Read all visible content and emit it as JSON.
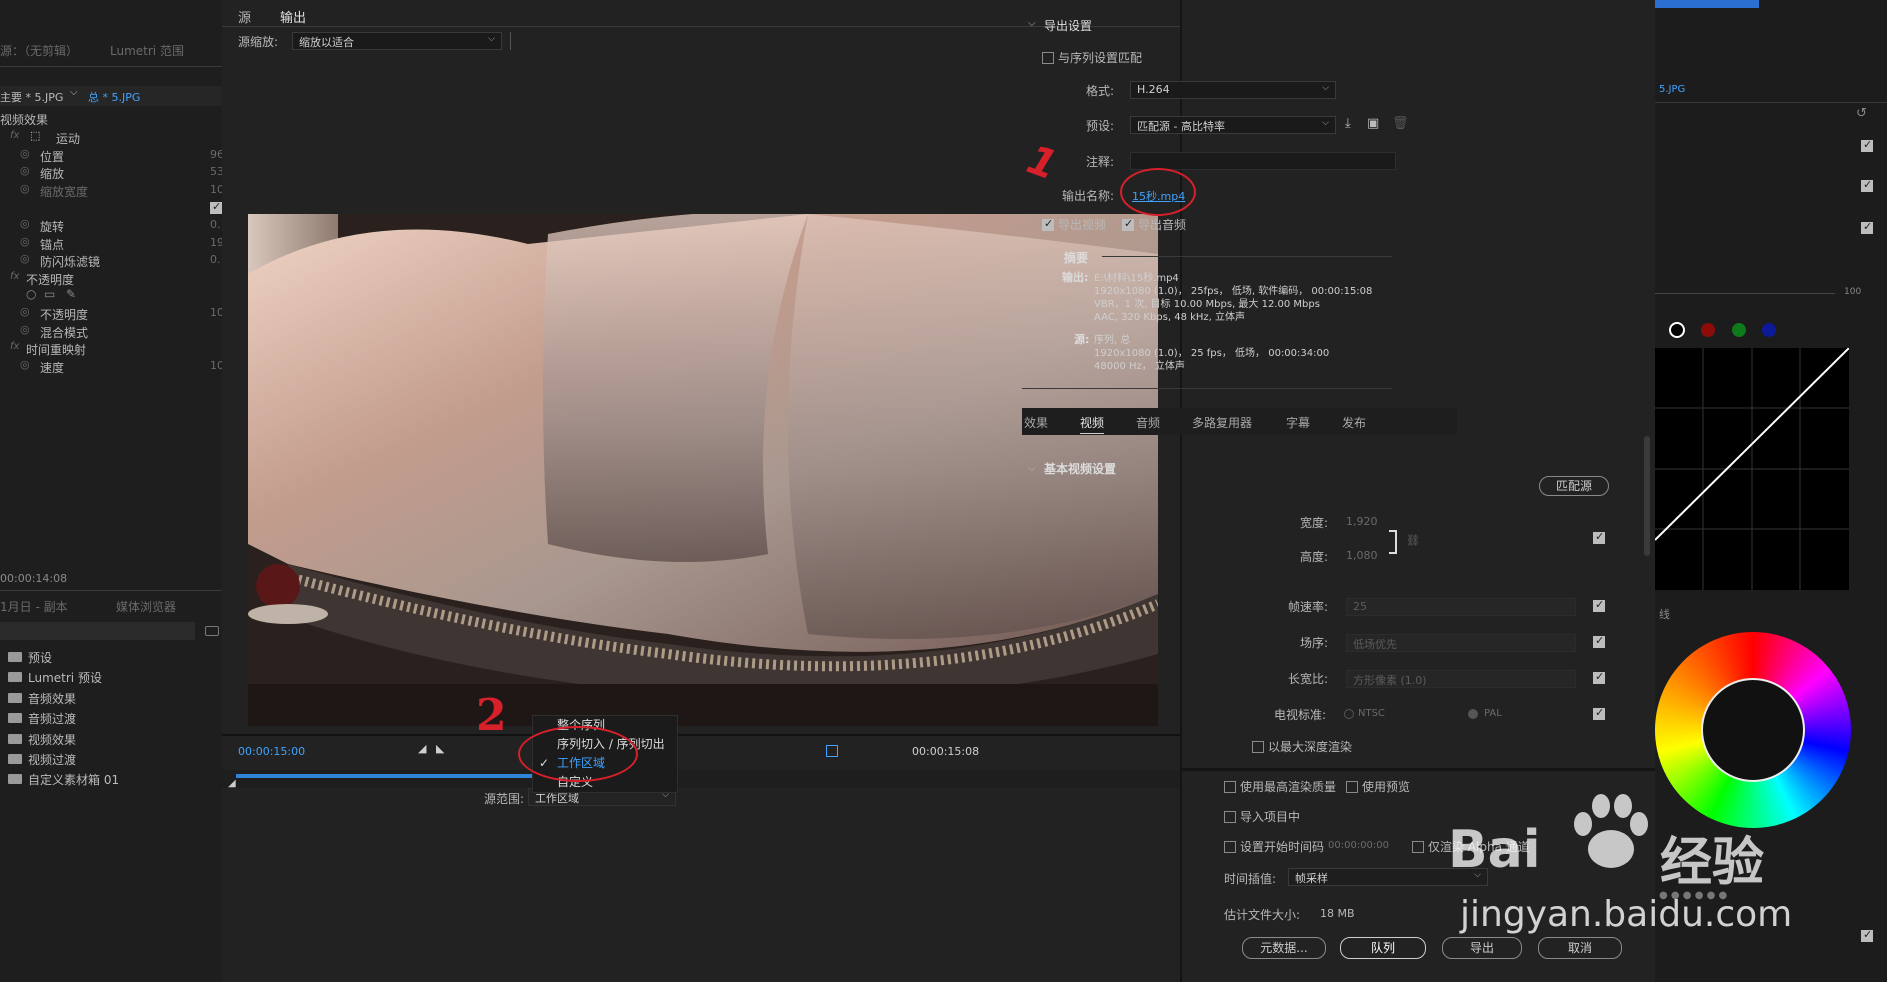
{
  "left_panel": {
    "tabs": [
      "源：（无剪辑）",
      "Lumetri 范围"
    ],
    "clip_tabs": [
      "主要 * 5.JPG",
      "总 * 5.JPG"
    ],
    "section_video_effects": "视频效果",
    "effects": [
      {
        "name": "运动",
        "value": "",
        "indent": 1,
        "fx": true,
        "icon": "motion-icon"
      },
      {
        "name": "位置",
        "value": "96",
        "indent": 2
      },
      {
        "name": "缩放",
        "value": "53",
        "indent": 2
      },
      {
        "name": "缩放宽度",
        "value": "10",
        "indent": 2,
        "faint": true
      },
      {
        "name": "",
        "value": "",
        "indent": 2,
        "checkbox": true
      },
      {
        "name": "旋转",
        "value": "0.",
        "indent": 2
      },
      {
        "name": "锚点",
        "value": "19",
        "indent": 2
      },
      {
        "name": "防闪烁滤镜",
        "value": "0.",
        "indent": 2
      },
      {
        "name": "不透明度",
        "value": "",
        "indent": 1,
        "fx": true
      },
      {
        "name": "",
        "value": "",
        "indent": 2,
        "shapes": true
      },
      {
        "name": "不透明度",
        "value": "10",
        "indent": 2
      },
      {
        "name": "混合模式",
        "value": "",
        "indent": 2
      },
      {
        "name": "时间重映射",
        "value": "",
        "indent": 1,
        "fx": true
      },
      {
        "name": "速度",
        "value": "10",
        "indent": 2
      }
    ],
    "timecode": "00:00:14:08",
    "project_tabs": [
      "1月日 - 副本",
      "媒体浏览器"
    ],
    "folders": [
      "预设",
      "Lumetri 预设",
      "音频效果",
      "音频过渡",
      "视频效果",
      "视频过渡",
      "自定义素材箱 01"
    ]
  },
  "dialog": {
    "tabs": [
      "源",
      "输出"
    ],
    "active_tab": "输出",
    "source_scaling_label": "源缩放:",
    "source_scaling_value": "缩放以适合",
    "timecode_start": "00:00:15:00",
    "timecode_end": "00:00:15:08",
    "source_range_label": "源范围:",
    "source_range_value": "工作区域",
    "source_range_options": [
      {
        "label": "整个序列",
        "selected": false
      },
      {
        "label": "序列切入 / 序列切出",
        "selected": false
      },
      {
        "label": "工作区域",
        "selected": true
      },
      {
        "label": "自定义",
        "selected": false
      }
    ],
    "annotation_1": "1",
    "annotation_2": "2"
  },
  "export_settings": {
    "title": "导出设置",
    "match_sequence": "与序列设置匹配",
    "format_label": "格式:",
    "format_value": "H.264",
    "preset_label": "预设:",
    "preset_value": "匹配源 - 高比特率",
    "comment_label": "注释:",
    "output_name_label": "输出名称:",
    "output_name_value": "15秒.mp4",
    "export_video": "导出视频",
    "export_audio": "导出音频",
    "summary_title": "摘要",
    "output_label": "输出:",
    "output_lines": [
      "E:\\材料\\15秒.mp4",
      "1920x1080 (1.0)， 25fps， 低场, 软件编码， 00:00:15:08",
      "VBR，1 次, 目标 10.00 Mbps, 最大 12.00 Mbps",
      "AAC, 320 Kbps, 48  kHz, 立体声"
    ],
    "source_label": "源:",
    "source_lines": [
      "序列, 总",
      "1920x1080 (1.0)， 25 fps， 低场， 00:00:34:00",
      "48000 Hz， 立体声"
    ]
  },
  "video_tabs": [
    "效果",
    "视频",
    "音频",
    "多路复用器",
    "字幕",
    "发布"
  ],
  "active_video_tab": "视频",
  "basic_video": {
    "title": "基本视频设置",
    "match_source_button": "匹配源",
    "width_label": "宽度:",
    "width_value": "1,920",
    "height_label": "高度:",
    "height_value": "1,080",
    "framerate_label": "帧速率:",
    "framerate_value": "25",
    "field_order_label": "场序:",
    "field_order_value": "低场优先",
    "aspect_label": "长宽比:",
    "aspect_value": "方形像素 (1.0)",
    "tv_standard_label": "电视标准:",
    "ntsc": "NTSC",
    "pal": "PAL",
    "max_depth": "以最大深度渲染"
  },
  "bottom": {
    "max_render_quality": "使用最高渲染质量",
    "use_previews": "使用预览",
    "import_into_project": "导入项目中",
    "set_start_timecode": "设置开始时间码",
    "start_timecode_value": "00:00:00:00",
    "render_alpha_only": "仅渲染 Alpha 通道",
    "time_interpolation_label": "时间插值:",
    "time_interpolation_value": "帧采样",
    "file_size_label": "估计文件大小:",
    "file_size_value": "18 MB",
    "buttons": {
      "metadata": "元数据...",
      "queue": "队列",
      "export": "导出",
      "cancel": "取消"
    }
  },
  "right_panel": {
    "clip_label": "5.JPG",
    "slider_value": "100",
    "cut_label": "线"
  },
  "watermark": {
    "brand": "Bai",
    "brand2": "经验",
    "url": "jingyan.baidu.com"
  },
  "colors": {
    "accent_blue": "#3fa3ff",
    "annotation_red": "#d8202a",
    "progress_blue": "#2f86d8"
  }
}
